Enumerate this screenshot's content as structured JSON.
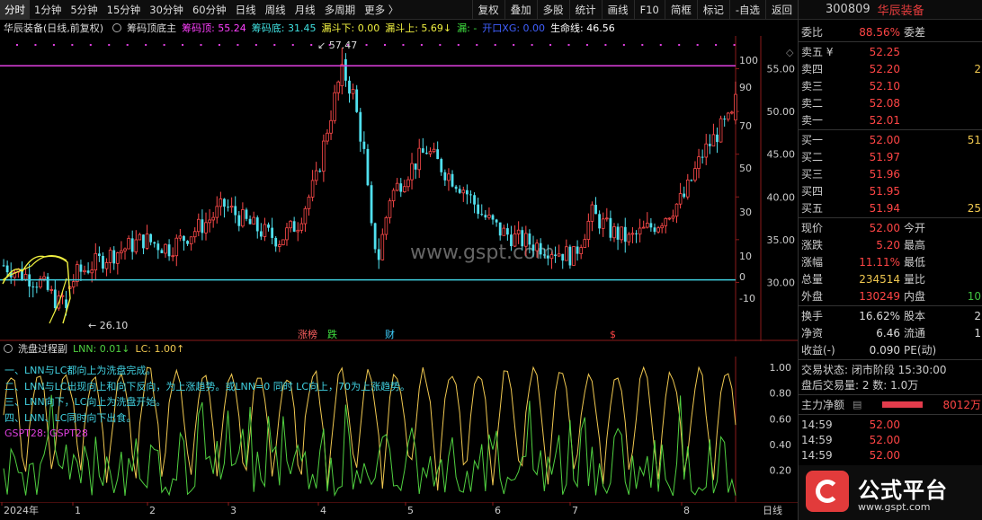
{
  "toolbar": {
    "periods": [
      "分时",
      "1分钟",
      "5分钟",
      "15分钟",
      "30分钟",
      "60分钟",
      "日线",
      "周线",
      "月线",
      "多周期",
      "更多 〉"
    ],
    "right": [
      "复权",
      "叠加",
      "多股",
      "统计",
      "画线",
      "F10",
      "简框",
      "标记",
      "-自选",
      "返回"
    ]
  },
  "indicator1": {
    "title": "华辰装备(日线,前复权)",
    "name": "筹码顶底主",
    "items": [
      {
        "t": "筹码顶: 55.24",
        "c": "#ff40ff"
      },
      {
        "t": "筹码底: 31.45",
        "c": "#40e0e0"
      },
      {
        "t": "漏斗下: 0.00",
        "c": "#f0f040"
      },
      {
        "t": "漏斗上: 5.69↓",
        "c": "#f0f040"
      },
      {
        "t": "漏: -",
        "c": "#40e040"
      },
      {
        "t": "开口XG: 0.00",
        "c": "#4060ff"
      },
      {
        "t": "生命线: 46.56",
        "c": "#ffffff"
      }
    ]
  },
  "indicator2": {
    "name": "洗盘过程副",
    "lnn": "LNN: 0.01↓",
    "lc": "LC: 1.00↑"
  },
  "notes": [
    "一、LNN与LC都向上为洗盘完成。",
    "二、LNN与LC出现向上和向下反向，为上涨趋势。或LNN=0 同时 LC向上，70为上涨趋势。",
    "三、LNN向下，LC向上为洗盘开始。",
    "四、LNN、LC同时向下出食。",
    "GSPT28: GSPT28"
  ],
  "chart_labels": {
    "high": "57.47",
    "low": "26.10",
    "watermark": "www.gspt.com",
    "marks": [
      "涨榜",
      "跌",
      "财",
      "$"
    ]
  },
  "price_axis": [
    "55.00",
    "50.00",
    "45.00",
    "40.00",
    "35.00",
    "30.00"
  ],
  "level_axis": [
    "100",
    "90",
    "70",
    "50",
    "30",
    "10",
    "0",
    "-10"
  ],
  "sub_axis": [
    "1.00",
    "0.80",
    "0.60",
    "0.40",
    "0.20"
  ],
  "time_axis": [
    "2024年",
    "1",
    "2",
    "3",
    "4",
    "5",
    "6",
    "7",
    "8"
  ],
  "time_axis_right": "日线",
  "chart_data": [
    {
      "type": "candlestick",
      "series": [
        {
          "name": "华辰装备",
          "values": []
        }
      ],
      "ylim": [
        25,
        58
      ],
      "hlines": [
        {
          "name": "筹码顶",
          "value": 55.24,
          "color": "#e040e0"
        },
        {
          "name": "筹码底",
          "value": 31.45,
          "color": "#40d0e0"
        }
      ],
      "annotations": [
        {
          "text": "57.47",
          "value": 57.47
        },
        {
          "text": "26.10",
          "value": 26.1
        }
      ]
    },
    {
      "type": "line",
      "series": [
        {
          "name": "LNN",
          "values": []
        },
        {
          "name": "LC",
          "values": []
        }
      ],
      "ylim": [
        0,
        1.05
      ]
    }
  ],
  "right": {
    "code": "300809",
    "name": "华辰装备",
    "weibi": {
      "label": "委比",
      "value": "88.56%",
      "label2": "委差"
    },
    "asks": [
      {
        "label": "卖五 ¥",
        "price": "52.25",
        "vol": ""
      },
      {
        "label": "卖四",
        "price": "52.20",
        "vol": "2"
      },
      {
        "label": "卖三",
        "price": "52.10",
        "vol": ""
      },
      {
        "label": "卖二",
        "price": "52.08",
        "vol": ""
      },
      {
        "label": "卖一",
        "price": "52.01",
        "vol": ""
      }
    ],
    "bids": [
      {
        "label": "买一",
        "price": "52.00",
        "vol": "51"
      },
      {
        "label": "买二",
        "price": "51.97",
        "vol": ""
      },
      {
        "label": "买三",
        "price": "51.96",
        "vol": ""
      },
      {
        "label": "买四",
        "price": "51.95",
        "vol": ""
      },
      {
        "label": "买五",
        "price": "51.94",
        "vol": "25"
      }
    ],
    "stats": [
      {
        "l": "现价",
        "v": "52.00",
        "c": "red",
        "l2": "今开"
      },
      {
        "l": "涨跌",
        "v": "5.20",
        "c": "red",
        "l2": "最高"
      },
      {
        "l": "涨幅",
        "v": "11.11%",
        "c": "red",
        "l2": "最低"
      },
      {
        "l": "总量",
        "v": "234514",
        "c": "yel",
        "l2": "量比"
      },
      {
        "l": "外盘",
        "v": "130249",
        "c": "red",
        "l2": "内盘",
        "v2": "10",
        "c2": "grn"
      }
    ],
    "stats2": [
      {
        "l": "换手",
        "v": "16.62%",
        "c": "wht",
        "l2": "股本",
        "v2": "2"
      },
      {
        "l": "净资",
        "v": "6.46",
        "c": "wht",
        "l2": "流通",
        "v2": "1"
      },
      {
        "l": "收益(-)",
        "v": "0.090",
        "c": "wht",
        "l2": "PE(动)"
      }
    ],
    "trade_state": "交易状态: 闭市阶段 15:30:00",
    "after_hours": "盘后交易量: 2  数: 1.0万",
    "main_flow": {
      "label": "主力净额",
      "value": "8012万"
    },
    "ticks": [
      {
        "t": "14:59",
        "p": "52.00"
      },
      {
        "t": "14:59",
        "p": "52.00"
      },
      {
        "t": "14:59",
        "p": "52.00"
      }
    ]
  },
  "logo": {
    "name": "公式平台",
    "url": "www.gspt.com"
  },
  "colors": {
    "up": "#ff4a4a",
    "down": "#50e0ee",
    "top_line": "#e040e0",
    "bottom_line": "#40d0e0",
    "lnn": "#50d040",
    "lc": "#f0c850"
  }
}
